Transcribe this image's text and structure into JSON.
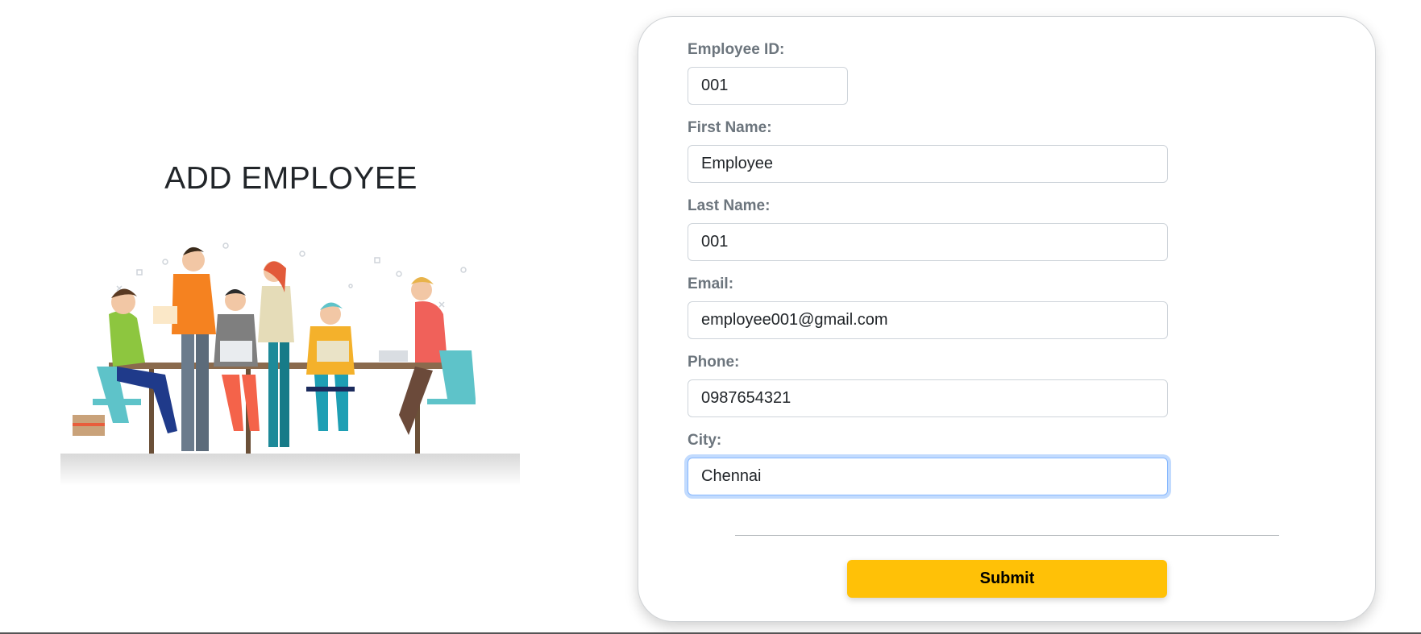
{
  "page": {
    "title": "ADD EMPLOYEE"
  },
  "form": {
    "fields": [
      {
        "label": "Employee ID:",
        "value": "001"
      },
      {
        "label": "First Name:",
        "value": "Employee"
      },
      {
        "label": "Last Name:",
        "value": "001"
      },
      {
        "label": "Email:",
        "value": "employee001@gmail.com"
      },
      {
        "label": "Phone:",
        "value": "0987654321"
      },
      {
        "label": "City:",
        "value": "Chennai"
      }
    ],
    "submit_label": "Submit"
  },
  "colors": {
    "accent": "#ffc107",
    "label": "#6c757d",
    "focus_ring": "#86b7fe"
  }
}
